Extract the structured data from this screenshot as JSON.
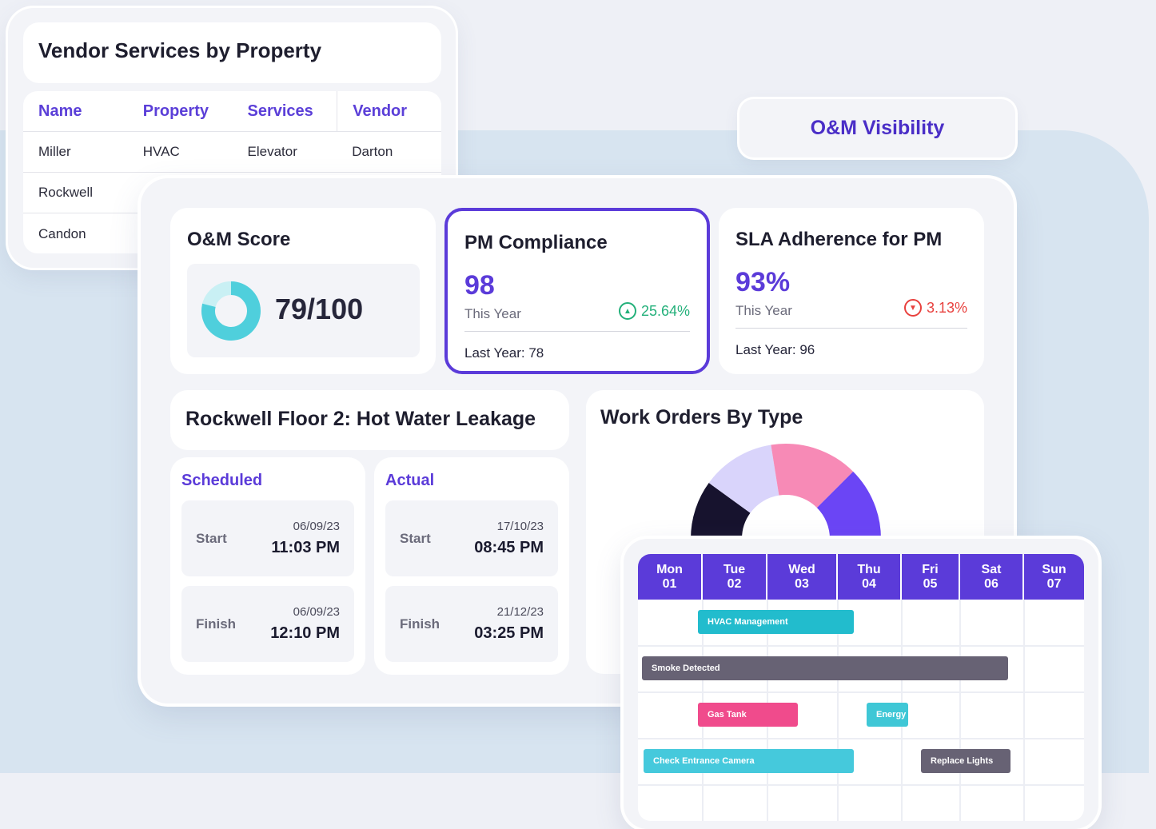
{
  "vendor_services": {
    "title": "Vendor Services by Property",
    "columns": [
      "Name",
      "Property",
      "Services",
      "Vendor"
    ],
    "rows": [
      [
        "Miller",
        "HVAC",
        "Elevator",
        "Darton"
      ],
      [
        "Rockwell",
        "",
        "",
        ""
      ],
      [
        "Candon",
        "",
        "",
        ""
      ]
    ]
  },
  "om_visibility": {
    "label": "O&M Visibility"
  },
  "score": {
    "title": "O&M Score",
    "value": "79/100",
    "fraction": 0.79,
    "colors": {
      "fill": "#4fcfdc",
      "track": "#c9f0f4"
    }
  },
  "pm_compliance": {
    "title": "PM Compliance",
    "value": "98",
    "period": "This Year",
    "delta": "25.64%",
    "direction": "up",
    "last_year": "Last Year: 78"
  },
  "sla": {
    "title": "SLA Adherence for PM",
    "value": "93%",
    "period": "This Year",
    "delta": "3.13%",
    "direction": "down",
    "last_year": "Last Year: 96"
  },
  "leak": {
    "title": "Rockwell Floor 2: Hot Water Leakage",
    "scheduled": {
      "label": "Scheduled",
      "start": {
        "kind": "Start",
        "date": "06/09/23",
        "time": "11:03 PM"
      },
      "finish": {
        "kind": "Finish",
        "date": "06/09/23",
        "time": "12:10 PM"
      }
    },
    "actual": {
      "label": "Actual",
      "start": {
        "kind": "Start",
        "date": "17/10/23",
        "time": "08:45 PM"
      },
      "finish": {
        "kind": "Finish",
        "date": "21/12/23",
        "time": "03:25 PM"
      }
    }
  },
  "work_orders": {
    "title": "Work Orders By Type",
    "chart_data": {
      "type": "pie",
      "style": "semi-donut",
      "slices": [
        {
          "value": 20,
          "color": "#17132e"
        },
        {
          "value": 25,
          "color": "#d9d4fb"
        },
        {
          "value": 30,
          "color": "#f78ab6"
        },
        {
          "value": 25,
          "color": "#6b45f5"
        }
      ]
    }
  },
  "calendar": {
    "days": [
      {
        "dow": "Mon",
        "date": "01"
      },
      {
        "dow": "Tue",
        "date": "02"
      },
      {
        "dow": "Wed",
        "date": "03"
      },
      {
        "dow": "Thu",
        "date": "04"
      },
      {
        "dow": "Fri",
        "date": "05"
      },
      {
        "dow": "Sat",
        "date": "06"
      },
      {
        "dow": "Sun",
        "date": "07"
      }
    ],
    "header_color": "#5b3bd9",
    "events": [
      {
        "label": "HVAC Management",
        "row": 0,
        "color": "#22bccd"
      },
      {
        "label": "Smoke Detected",
        "row": 1,
        "color": "#676274"
      },
      {
        "label": "Gas Tank",
        "row": 2,
        "color": "#f04b8c"
      },
      {
        "label": "Energy",
        "row": 2,
        "color": "#3fc7d6"
      },
      {
        "label": "Check Entrance Camera",
        "row": 3,
        "color": "#45c9dc"
      },
      {
        "label": "Replace Lights",
        "row": 3,
        "color": "#676274"
      }
    ]
  }
}
